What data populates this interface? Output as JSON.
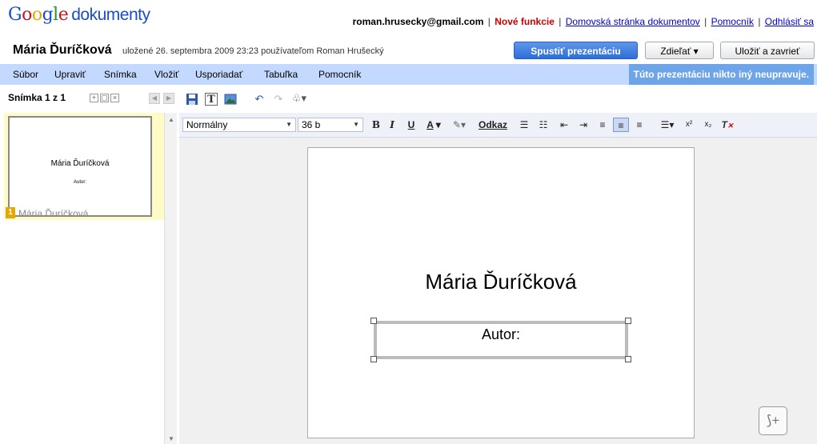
{
  "header": {
    "logo": {
      "g1": "G",
      "g2": "o",
      "g3": "o",
      "g4": "g",
      "g5": "l",
      "g6": "e",
      "product": "dokumenty"
    },
    "email": "roman.hrusecky@gmail.com",
    "sep": "|",
    "new_features": "Nové funkcie",
    "docs_home": "Domovská stránka dokumentov",
    "help": "Pomocník",
    "sign_out": "Odhlásiť sa"
  },
  "document": {
    "title": "Mária Ďuríčková",
    "save_info": "uložené 26. septembra 2009 23:23 používateľom Roman Hrušecký"
  },
  "buttons": {
    "start_presentation": "Spustiť prezentáciu",
    "share": "Zdieľať ▾",
    "save_close": "Uložiť a zavrieť"
  },
  "menu": {
    "file": "Súbor",
    "edit": "Upraviť",
    "slide": "Snímka",
    "insert": "Vložiť",
    "arrange": "Usporiadať",
    "table": "Tabuľka",
    "help": "Pomocník",
    "editors_msg": "Túto prezentáciu nikto iný neupravuje."
  },
  "slides_panel": {
    "header": "Snímka 1 z 1",
    "thumb_title": "Mária Ďuríčková",
    "thumb_subtitle": "Autor:",
    "thumb_number": "1",
    "thumb_label": "Mária Ďuríčková"
  },
  "format_bar": {
    "style": "Normálny",
    "size": "36 b",
    "bold": "B",
    "italic": "I",
    "underline": "U",
    "link": "Odkaz"
  },
  "slide": {
    "title": "Mária Ďuríčková",
    "subtitle": "Autor:"
  },
  "icons": {
    "save": "save-icon",
    "text": "text-box-icon",
    "image": "image-icon",
    "undo": "undo-icon",
    "redo": "redo-icon",
    "fill": "fill-icon",
    "add_note": "add-note-icon"
  },
  "colors": {
    "menu_bg": "#c3d9ff",
    "accent": "#2d6ed8",
    "new_features": "#cc0000",
    "thumb_highlight": "#fffbc6"
  }
}
